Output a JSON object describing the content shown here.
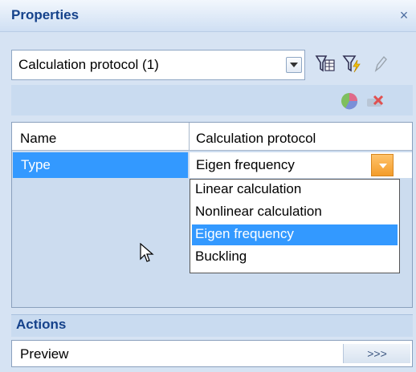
{
  "window": {
    "title": "Properties",
    "close_glyph": "×"
  },
  "selector": {
    "value": "Calculation protocol (1)"
  },
  "toolbar": {
    "icons": [
      "filter-table-icon",
      "filter-lightning-icon",
      "pencil-icon"
    ],
    "secondary_icons": [
      "pie-chart-icon",
      "delete-x-icon"
    ]
  },
  "grid": {
    "headers": {
      "name": "Name",
      "value": "Calculation protocol"
    },
    "row": {
      "name": "Type",
      "value": "Eigen frequency"
    },
    "dropdown_options": [
      "Linear calculation",
      "Nonlinear calculation",
      "Eigen frequency",
      "Buckling"
    ],
    "selected_option": "Eigen frequency"
  },
  "actions": {
    "section_title": "Actions",
    "items": [
      {
        "label": "Preview",
        "button": ">>>"
      }
    ]
  },
  "colors": {
    "accent": "#3399ff",
    "panel": "#d6e3f3",
    "title_text": "#15428b",
    "dropdown_button": "#f39c2a"
  }
}
